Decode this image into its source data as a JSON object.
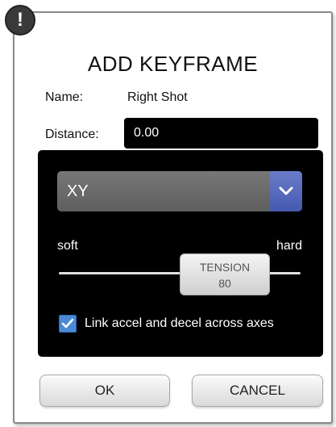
{
  "dialog": {
    "badge_icon": "!",
    "title": "ADD KEYFRAME",
    "name_label": "Name:",
    "name_value": "Right Shot",
    "distance_label": "Distance:",
    "distance_value": "0.00"
  },
  "panel": {
    "axis_select": {
      "selected": "XY",
      "arrow_icon": "chevron-down-icon",
      "accent_color": "#4559b0"
    },
    "tension": {
      "soft_label": "soft",
      "hard_label": "hard",
      "thumb_title": "TENSION",
      "value": "80"
    },
    "link_checkbox": {
      "checked": true,
      "label": "Link accel and decel across axes",
      "color": "#4a8ad4"
    }
  },
  "buttons": {
    "ok_label": "OK",
    "cancel_label": "CANCEL"
  }
}
